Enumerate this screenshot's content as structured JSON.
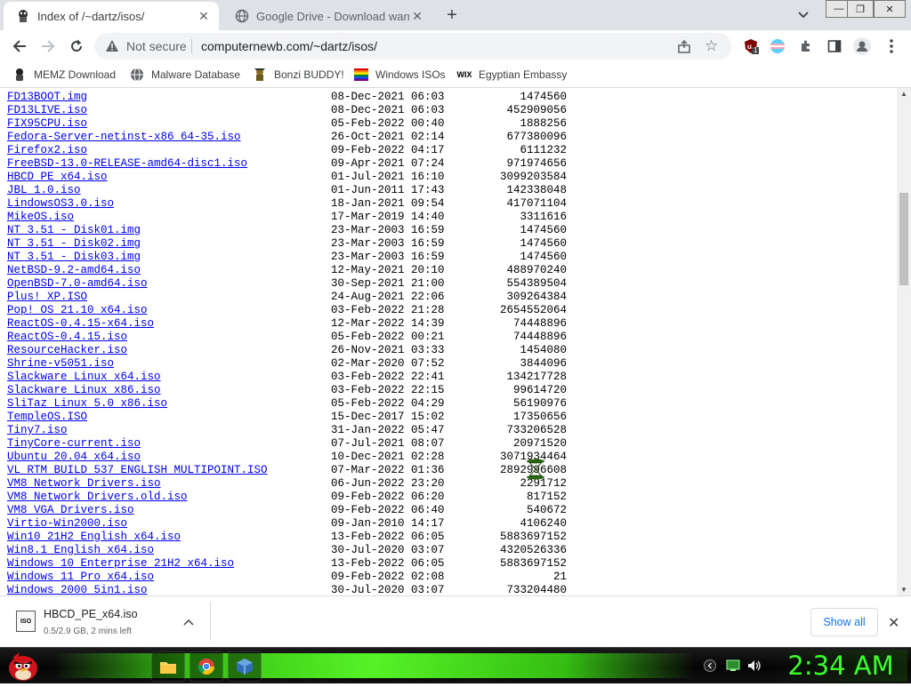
{
  "tabs": [
    {
      "title": "Index of /~dartz/isos/",
      "active": true
    },
    {
      "title": "Google Drive - Download warnin",
      "active": false
    }
  ],
  "toolbar": {
    "security_label": "Not secure",
    "url": "computernewb.com/~dartz/isos/",
    "extension_badge": "1"
  },
  "bookmarks": [
    {
      "label": "MEMZ Download",
      "icon": "memz-icon"
    },
    {
      "label": "Malware Database",
      "icon": "globe-icon"
    },
    {
      "label": "Bonzi BUDDY!",
      "icon": "bonzi-icon"
    },
    {
      "label": "Windows ISOs",
      "icon": "rainbow-flag-icon"
    },
    {
      "label": "Egyptian Embassy",
      "icon": "wix-icon"
    }
  ],
  "listing": [
    {
      "name": "FD13BOOT.img",
      "date": "08-Dec-2021 06:03",
      "size": "1474560"
    },
    {
      "name": "FD13LIVE.iso",
      "date": "08-Dec-2021 06:03",
      "size": "452909056"
    },
    {
      "name": "FIX95CPU.iso",
      "date": "05-Feb-2022 00:40",
      "size": "1888256"
    },
    {
      "name": "Fedora-Server-netinst-x86_64-35.iso",
      "date": "26-Oct-2021 02:14",
      "size": "677380096"
    },
    {
      "name": "Firefox2.iso",
      "date": "09-Feb-2022 04:17",
      "size": "6111232"
    },
    {
      "name": "FreeBSD-13.0-RELEASE-amd64-disc1.iso",
      "date": "09-Apr-2021 07:24",
      "size": "971974656"
    },
    {
      "name": "HBCD_PE_x64.iso",
      "date": "01-Jul-2021 16:10",
      "size": "3099203584"
    },
    {
      "name": "JBL_1.0.iso",
      "date": "01-Jun-2011 17:43",
      "size": "142338048"
    },
    {
      "name": "LindowsOS3.0.iso",
      "date": "18-Jan-2021 09:54",
      "size": "417071104"
    },
    {
      "name": "MikeOS.iso",
      "date": "17-Mar-2019 14:40",
      "size": "3311616"
    },
    {
      "name": "NT_3.51_-_Disk01.img",
      "date": "23-Mar-2003 16:59",
      "size": "1474560"
    },
    {
      "name": "NT_3.51_-_Disk02.img",
      "date": "23-Mar-2003 16:59",
      "size": "1474560"
    },
    {
      "name": "NT_3.51_-_Disk03.img",
      "date": "23-Mar-2003 16:59",
      "size": "1474560"
    },
    {
      "name": "NetBSD-9.2-amd64.iso",
      "date": "12-May-2021 20:10",
      "size": "488970240"
    },
    {
      "name": "OpenBSD-7.0-amd64.iso",
      "date": "30-Sep-2021 21:00",
      "size": "554389504"
    },
    {
      "name": "Plus!_XP.ISO",
      "date": "24-Aug-2021 22:06",
      "size": "309264384"
    },
    {
      "name": "Pop!_OS_21.10_x64.iso",
      "date": "03-Feb-2022 21:28",
      "size": "2654552064"
    },
    {
      "name": "ReactOS-0.4.15-x64.iso",
      "date": "12-Mar-2022 14:39",
      "size": "74448896"
    },
    {
      "name": "ReactOS-0.4.15.iso",
      "date": "05-Feb-2022 00:21",
      "size": "74448896"
    },
    {
      "name": "ResourceHacker.iso",
      "date": "26-Nov-2021 03:33",
      "size": "1454080"
    },
    {
      "name": "Shrine-v5051.iso",
      "date": "02-Mar-2020 07:52",
      "size": "3844096"
    },
    {
      "name": "Slackware_Linux_x64.iso",
      "date": "03-Feb-2022 22:41",
      "size": "134217728"
    },
    {
      "name": "Slackware_Linux_x86.iso",
      "date": "03-Feb-2022 22:15",
      "size": "99614720"
    },
    {
      "name": "SliTaz_Linux_5.0_x86.iso",
      "date": "05-Feb-2022 04:29",
      "size": "56190976"
    },
    {
      "name": "TempleOS.ISO",
      "date": "15-Dec-2017 15:02",
      "size": "17350656"
    },
    {
      "name": "Tiny7.iso",
      "date": "31-Jan-2022 05:47",
      "size": "733206528"
    },
    {
      "name": "TinyCore-current.iso",
      "date": "07-Jul-2021 08:07",
      "size": "20971520"
    },
    {
      "name": "Ubuntu_20.04_x64.iso",
      "date": "10-Dec-2021 02:28",
      "size": "3071934464"
    },
    {
      "name": "VL_RTM_BUILD_537_ENGLISH_MULTIPOINT.ISO",
      "date": "07-Mar-2022 01:36",
      "size": "2892996608"
    },
    {
      "name": "VM8_Network_Drivers.iso",
      "date": "06-Jun-2022 23:20",
      "size": "2291712"
    },
    {
      "name": "VM8_Network_Drivers.old.iso",
      "date": "09-Feb-2022 06:20",
      "size": "817152"
    },
    {
      "name": "VM8_VGA_Drivers.iso",
      "date": "09-Feb-2022 06:40",
      "size": "540672"
    },
    {
      "name": "Virtio-Win2000.iso",
      "date": "09-Jan-2010 14:17",
      "size": "4106240"
    },
    {
      "name": "Win10_21H2_English_x64.iso",
      "date": "13-Feb-2022 06:05",
      "size": "5883697152"
    },
    {
      "name": "Win8.1_English_x64.iso",
      "date": "30-Jul-2020 03:07",
      "size": "4320526336"
    },
    {
      "name": "Windows_10_Enterprise_21H2_x64.iso",
      "date": "13-Feb-2022 06:05",
      "size": "5883697152"
    },
    {
      "name": "Windows_11_Pro_x64.iso",
      "date": "09-Feb-2022 02:08",
      "size": "21"
    },
    {
      "name": "Windows_2000_5in1.iso",
      "date": "30-Jul-2020 03:07",
      "size": "733204480"
    }
  ],
  "download": {
    "icon_text": "ISO",
    "filename": "HBCD_PE_x64.iso",
    "status": "0.5/2.9 GB, 2 mins left",
    "show_all": "Show all"
  },
  "taskbar": {
    "clock": "2:34 AM",
    "apps": [
      "file-explorer-icon",
      "chrome-icon",
      "virtualbox-icon"
    ]
  },
  "colors": {
    "link": "#0000ee",
    "tabstrip": "#dee1e6",
    "clock": "#3cff2e",
    "taskbar_glow": "#5aff28"
  }
}
